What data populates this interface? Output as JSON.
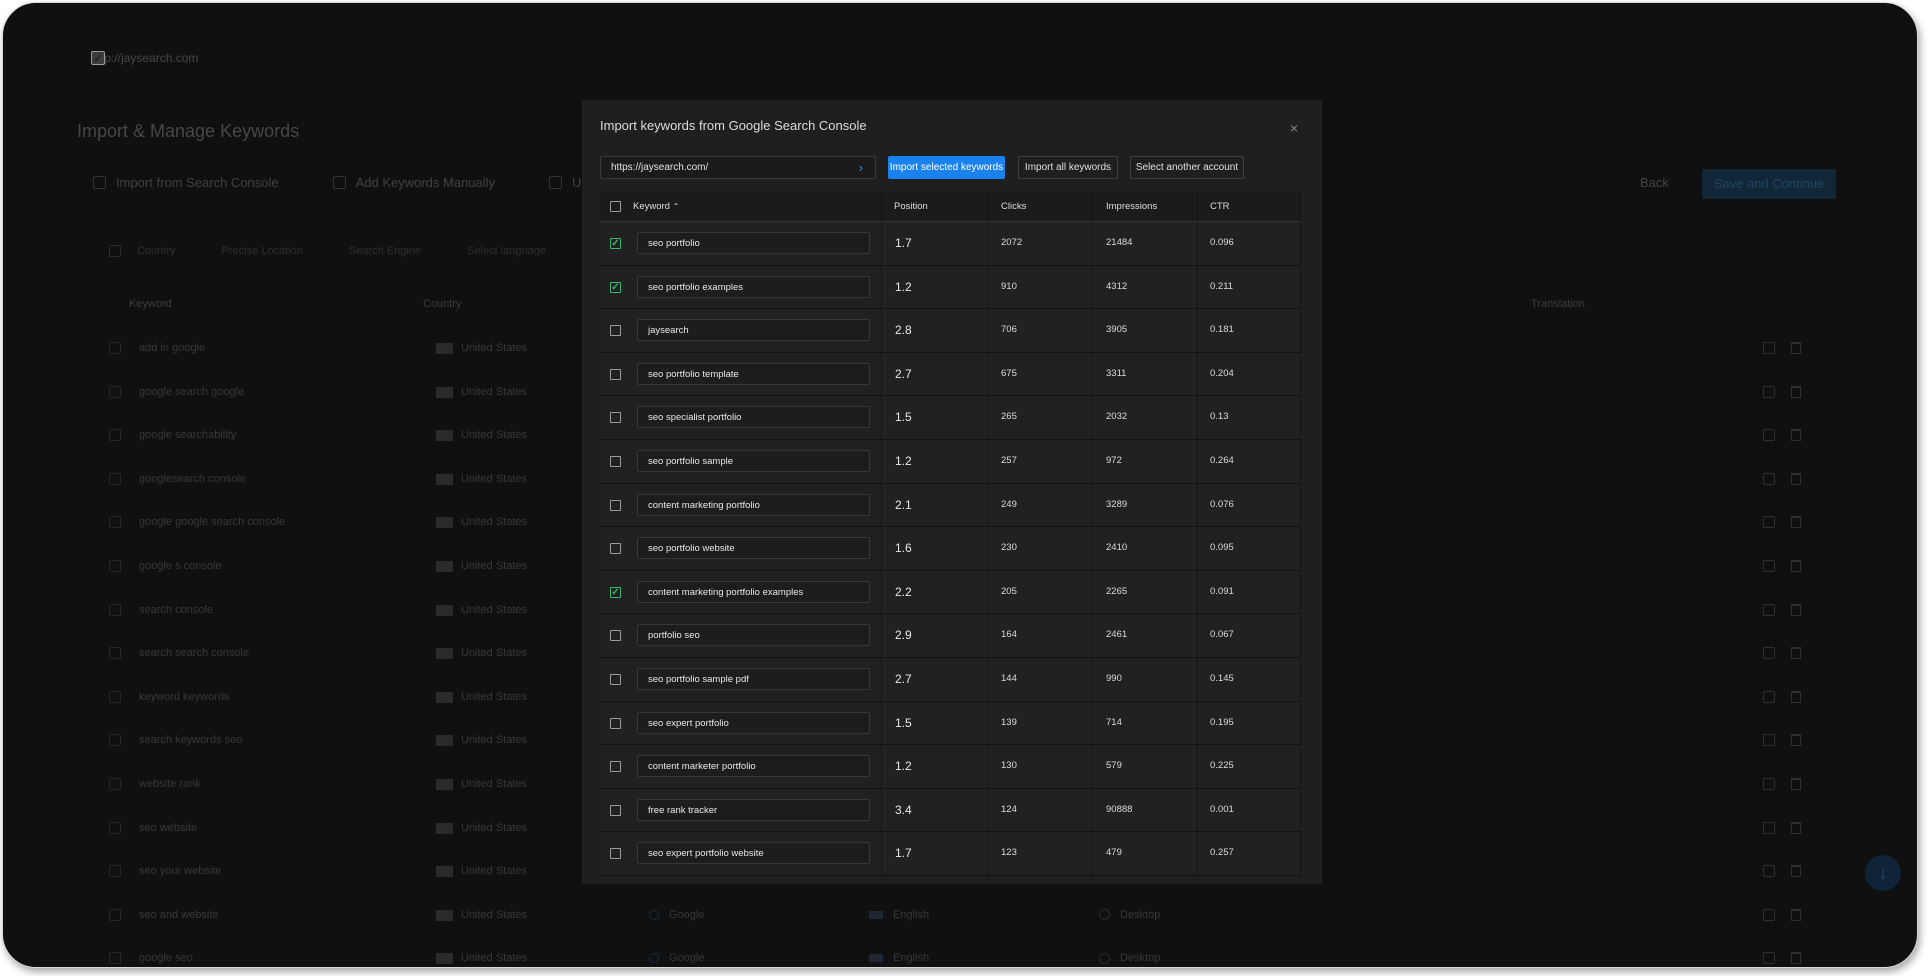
{
  "background": {
    "site_url": "http://jaysearch.com",
    "page_title": "Import & Manage Keywords",
    "tabs": [
      "Import from Search Console",
      "Add Keywords Manually",
      "Upload C"
    ],
    "back_label": "Back",
    "save_label": "Save and Continue",
    "filters": [
      "Country",
      "Precise Location",
      "Search Engine",
      "Select language"
    ],
    "columns": {
      "keyword": "Keyword",
      "country": "Country",
      "translation": "Translation"
    },
    "rows": [
      {
        "keyword": "add in google",
        "country": "United States"
      },
      {
        "keyword": "google search google",
        "country": "United States"
      },
      {
        "keyword": "google searchability",
        "country": "United States"
      },
      {
        "keyword": "googlesearch console",
        "country": "United States"
      },
      {
        "keyword": "google google search console",
        "country": "United States"
      },
      {
        "keyword": "google s console",
        "country": "United States"
      },
      {
        "keyword": "search console",
        "country": "United States"
      },
      {
        "keyword": "search search console",
        "country": "United States"
      },
      {
        "keyword": "keyword keywords",
        "country": "United States"
      },
      {
        "keyword": "search keywords seo",
        "country": "United States"
      },
      {
        "keyword": "website rank",
        "country": "United States"
      },
      {
        "keyword": "seo website",
        "country": "United States"
      },
      {
        "keyword": "seo your website",
        "country": "United States"
      },
      {
        "keyword": "seo and website",
        "country": "United States",
        "engine": "Google",
        "language": "English",
        "device": "Desktop"
      },
      {
        "keyword": "google seo",
        "country": "United States",
        "engine": "Google",
        "language": "English",
        "device": "Desktop"
      }
    ]
  },
  "modal": {
    "title": "Import keywords from Google Search Console",
    "close": "×",
    "url_value": "https://jaysearch.com/",
    "buttons": {
      "import_selected": "Import selected keywords",
      "import_all": "Import all keywords",
      "select_account": "Select another account"
    },
    "columns": {
      "keyword": "Keyword",
      "sort_icon": "⌃",
      "position": "Position",
      "clicks": "Clicks",
      "impressions": "Impressions",
      "ctr": "CTR"
    },
    "rows": [
      {
        "checked": true,
        "keyword": "seo portfolio",
        "position": "1.7",
        "clicks": "2072",
        "impressions": "21484",
        "ctr": "0.096"
      },
      {
        "checked": true,
        "keyword": "seo portfolio examples",
        "position": "1.2",
        "clicks": "910",
        "impressions": "4312",
        "ctr": "0.211"
      },
      {
        "checked": false,
        "keyword": "jaysearch",
        "position": "2.8",
        "clicks": "706",
        "impressions": "3905",
        "ctr": "0.181"
      },
      {
        "checked": false,
        "keyword": "seo portfolio template",
        "position": "2.7",
        "clicks": "675",
        "impressions": "3311",
        "ctr": "0.204"
      },
      {
        "checked": false,
        "keyword": "seo specialist portfolio",
        "position": "1.5",
        "clicks": "265",
        "impressions": "2032",
        "ctr": "0.13"
      },
      {
        "checked": false,
        "keyword": "seo portfolio sample",
        "position": "1.2",
        "clicks": "257",
        "impressions": "972",
        "ctr": "0.264"
      },
      {
        "checked": false,
        "keyword": "content marketing portfolio",
        "position": "2.1",
        "clicks": "249",
        "impressions": "3289",
        "ctr": "0.076"
      },
      {
        "checked": false,
        "keyword": "seo portfolio website",
        "position": "1.6",
        "clicks": "230",
        "impressions": "2410",
        "ctr": "0.095"
      },
      {
        "checked": true,
        "keyword": "content marketing portfolio examples",
        "position": "2.2",
        "clicks": "205",
        "impressions": "2265",
        "ctr": "0.091"
      },
      {
        "checked": false,
        "keyword": "portfolio seo",
        "position": "2.9",
        "clicks": "164",
        "impressions": "2461",
        "ctr": "0.067"
      },
      {
        "checked": false,
        "keyword": "seo portfolio sample pdf",
        "position": "2.7",
        "clicks": "144",
        "impressions": "990",
        "ctr": "0.145"
      },
      {
        "checked": false,
        "keyword": "seo expert portfolio",
        "position": "1.5",
        "clicks": "139",
        "impressions": "714",
        "ctr": "0.195"
      },
      {
        "checked": false,
        "keyword": "content marketer portfolio",
        "position": "1.2",
        "clicks": "130",
        "impressions": "579",
        "ctr": "0.225"
      },
      {
        "checked": false,
        "keyword": "free rank tracker",
        "position": "3.4",
        "clicks": "124",
        "impressions": "90888",
        "ctr": "0.001"
      },
      {
        "checked": false,
        "keyword": "seo expert portfolio website",
        "position": "1.7",
        "clicks": "123",
        "impressions": "479",
        "ctr": "0.257"
      }
    ]
  },
  "colors": {
    "accent": "#1a82ef",
    "check": "#3cb371",
    "modal_bg": "#1f1f1f"
  }
}
